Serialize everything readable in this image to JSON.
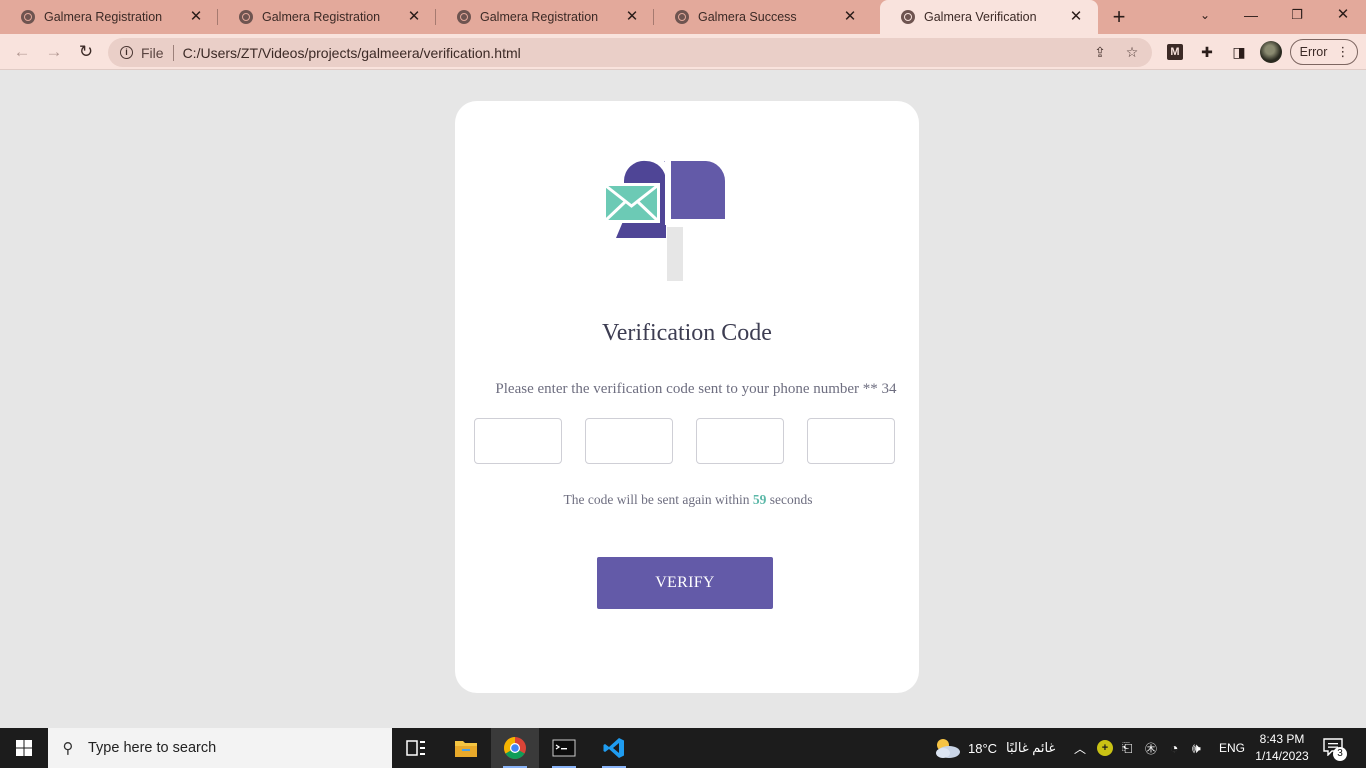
{
  "browser": {
    "tabs": [
      {
        "title": "Galmera Registration",
        "active": false
      },
      {
        "title": "Galmera Registration",
        "active": false
      },
      {
        "title": "Galmera Registration",
        "active": false
      },
      {
        "title": "Galmera Success",
        "active": false
      },
      {
        "title": "Galmera Verification",
        "active": true
      }
    ],
    "new_tab_icon": "plus-icon",
    "address": {
      "scheme_label": "File",
      "url": "C:/Users/ZT/Videos/projects/galmeera/verification.html"
    },
    "error_label": "Error"
  },
  "page": {
    "title": "Verification Code",
    "instruction": "Please enter the verification code sent to your phone number ** 34",
    "code_inputs": [
      "",
      "",
      "",
      ""
    ],
    "resend_prefix": "The code will be sent again within",
    "resend_seconds": "59",
    "resend_suffix": "seconds",
    "verify_label": "VERIFY",
    "colors": {
      "accent": "#635aa8",
      "mailbox_dark": "#4f4596",
      "envelope": "#6ccab5",
      "countdown": "#5cb8a8",
      "background": "#e6e6e6"
    }
  },
  "taskbar": {
    "search_placeholder": "Type here to search",
    "weather_temp": "18°C",
    "weather_desc": "غائم غالبًا",
    "language": "ENG",
    "time": "8:43 PM",
    "date": "1/14/2023",
    "notification_count": "3"
  }
}
